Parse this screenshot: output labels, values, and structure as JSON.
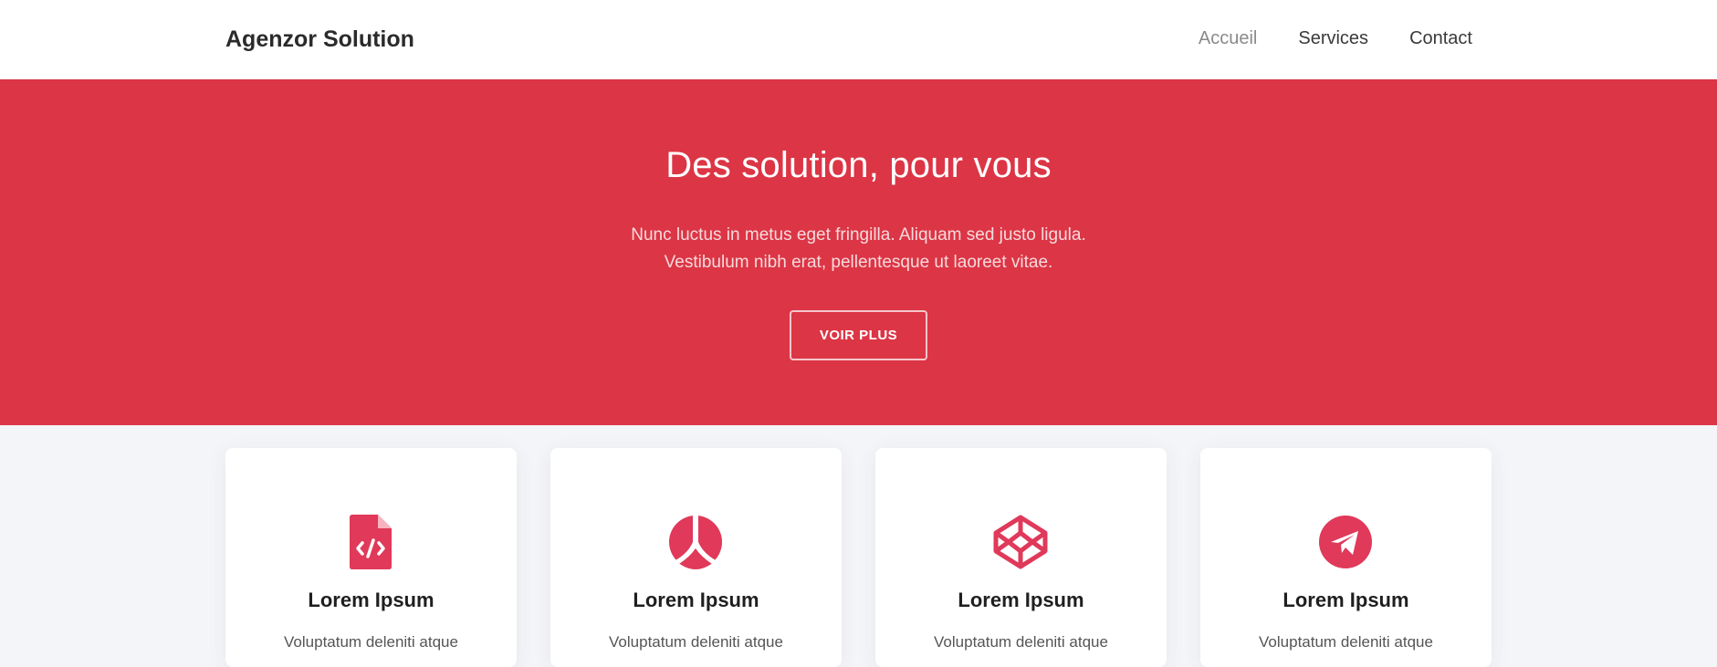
{
  "brand": "Agenzor Solution",
  "nav": [
    {
      "label": "Accueil",
      "active": true
    },
    {
      "label": "Services",
      "active": false
    },
    {
      "label": "Contact",
      "active": false
    }
  ],
  "hero": {
    "title": "Des solution, pour vous",
    "line1": "Nunc luctus in metus eget fringilla. Aliquam sed justo ligula.",
    "line2": "Vestibulum nibh erat, pellentesque ut laoreet vitae.",
    "button": "VOIR PLUS"
  },
  "cards": [
    {
      "icon": "file-code-icon",
      "title": "Lorem Ipsum",
      "text": "Voluptatum deleniti atque"
    },
    {
      "icon": "ethereum-icon",
      "title": "Lorem Ipsum",
      "text": "Voluptatum deleniti atque"
    },
    {
      "icon": "codepen-icon",
      "title": "Lorem Ipsum",
      "text": "Voluptatum deleniti atque"
    },
    {
      "icon": "paper-plane-icon",
      "title": "Lorem Ipsum",
      "text": "Voluptatum deleniti atque"
    }
  ],
  "colors": {
    "accent": "#dc3545",
    "icon": "#e0395a"
  }
}
